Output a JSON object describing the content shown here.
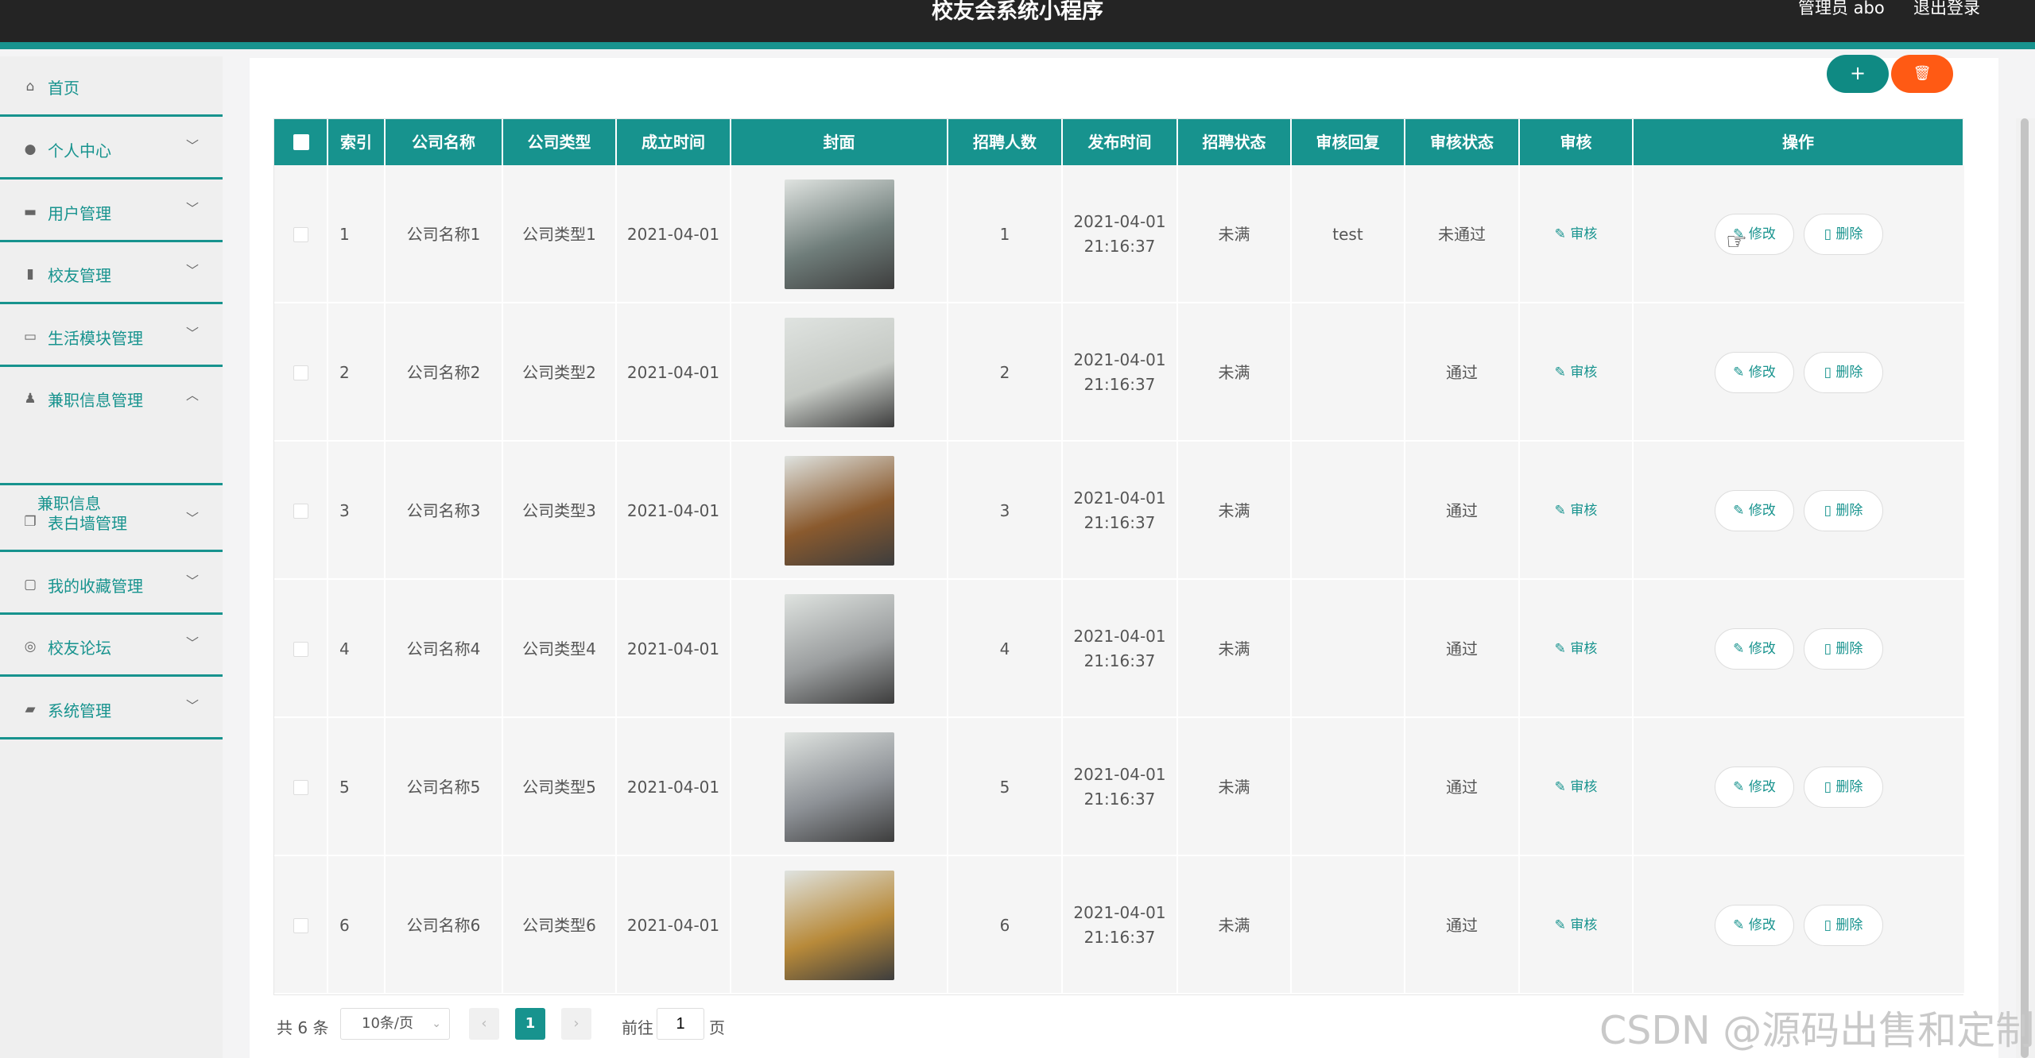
{
  "header": {
    "title": "校友会系统小程序",
    "user": "管理员 abo",
    "logout": "退出登录"
  },
  "sidebar": {
    "items": [
      {
        "label": "首页",
        "icon": "home-icon",
        "expandable": false
      },
      {
        "label": "个人中心",
        "icon": "user-icon",
        "expandable": true
      },
      {
        "label": "用户管理",
        "icon": "users-icon",
        "expandable": true
      },
      {
        "label": "校友管理",
        "icon": "clipboard-icon",
        "expandable": true
      },
      {
        "label": "生活模块管理",
        "icon": "card-icon",
        "expandable": true
      },
      {
        "label": "兼职信息管理",
        "icon": "person-icon",
        "expandable": true,
        "expanded": true,
        "sub_items": [
          "兼职信息"
        ]
      },
      {
        "label": "表白墙管理",
        "icon": "copy-icon",
        "expandable": true
      },
      {
        "label": "我的收藏管理",
        "icon": "chat-icon",
        "expandable": true
      },
      {
        "label": "校友论坛",
        "icon": "compass-icon",
        "expandable": true
      },
      {
        "label": "系统管理",
        "icon": "video-icon",
        "expandable": true
      }
    ]
  },
  "toolbar": {
    "add_label": "+",
    "delete_icon": "trash-icon"
  },
  "table": {
    "headers": [
      "索引",
      "公司名称",
      "公司类型",
      "成立时间",
      "封面",
      "招聘人数",
      "发布时间",
      "招聘状态",
      "审核回复",
      "审核状态",
      "审核",
      "操作"
    ],
    "audit_label": "审核",
    "edit_label": "修改",
    "delete_label": "删除",
    "rows": [
      {
        "index": "1",
        "company": "公司名称1",
        "type": "公司类型1",
        "founded": "2021-04-01",
        "headcount": "1",
        "pub_date": "2021-04-01",
        "pub_time": "21:16:37",
        "status": "未满",
        "reply": "test",
        "audit_status": "未通过",
        "cover_color": "#6f7d7a"
      },
      {
        "index": "2",
        "company": "公司名称2",
        "type": "公司类型2",
        "founded": "2021-04-01",
        "headcount": "2",
        "pub_date": "2021-04-01",
        "pub_time": "21:16:37",
        "status": "未满",
        "reply": "",
        "audit_status": "通过",
        "cover_color": "#c5c9c4"
      },
      {
        "index": "3",
        "company": "公司名称3",
        "type": "公司类型3",
        "founded": "2021-04-01",
        "headcount": "3",
        "pub_date": "2021-04-01",
        "pub_time": "21:16:37",
        "status": "未满",
        "reply": "",
        "audit_status": "通过",
        "cover_color": "#8a5a2e"
      },
      {
        "index": "4",
        "company": "公司名称4",
        "type": "公司类型4",
        "founded": "2021-04-01",
        "headcount": "4",
        "pub_date": "2021-04-01",
        "pub_time": "21:16:37",
        "status": "未满",
        "reply": "",
        "audit_status": "通过",
        "cover_color": "#9a9d9e"
      },
      {
        "index": "5",
        "company": "公司名称5",
        "type": "公司类型5",
        "founded": "2021-04-01",
        "headcount": "5",
        "pub_date": "2021-04-01",
        "pub_time": "21:16:37",
        "status": "未满",
        "reply": "",
        "audit_status": "通过",
        "cover_color": "#8d9196"
      },
      {
        "index": "6",
        "company": "公司名称6",
        "type": "公司类型6",
        "founded": "2021-04-01",
        "headcount": "6",
        "pub_date": "2021-04-01",
        "pub_time": "21:16:37",
        "status": "未满",
        "reply": "",
        "audit_status": "通过",
        "cover_color": "#b88a3a"
      }
    ]
  },
  "pagination": {
    "total": "共 6 条",
    "page_size": "10条/页",
    "current_page": "1",
    "goto_label": "前往",
    "goto_value": "1",
    "page_unit": "页"
  },
  "watermark": "CSDN @源码出售和定制"
}
